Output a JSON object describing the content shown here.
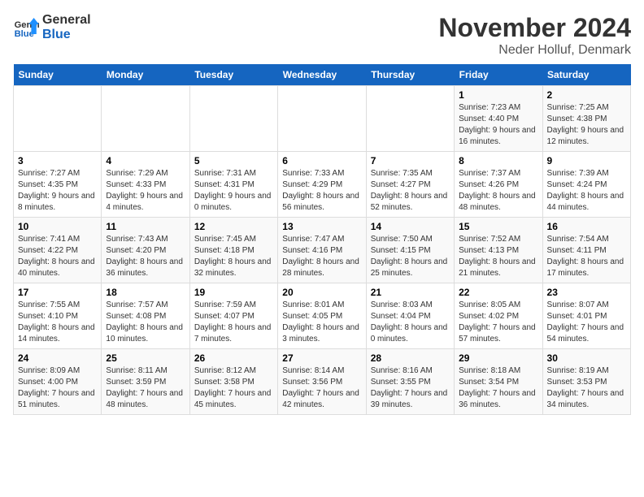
{
  "header": {
    "logo_line1": "General",
    "logo_line2": "Blue",
    "title": "November 2024",
    "subtitle": "Neder Holluf, Denmark"
  },
  "days_of_week": [
    "Sunday",
    "Monday",
    "Tuesday",
    "Wednesday",
    "Thursday",
    "Friday",
    "Saturday"
  ],
  "weeks": [
    [
      {
        "day": "",
        "detail": ""
      },
      {
        "day": "",
        "detail": ""
      },
      {
        "day": "",
        "detail": ""
      },
      {
        "day": "",
        "detail": ""
      },
      {
        "day": "",
        "detail": ""
      },
      {
        "day": "1",
        "detail": "Sunrise: 7:23 AM\nSunset: 4:40 PM\nDaylight: 9 hours and 16 minutes."
      },
      {
        "day": "2",
        "detail": "Sunrise: 7:25 AM\nSunset: 4:38 PM\nDaylight: 9 hours and 12 minutes."
      }
    ],
    [
      {
        "day": "3",
        "detail": "Sunrise: 7:27 AM\nSunset: 4:35 PM\nDaylight: 9 hours and 8 minutes."
      },
      {
        "day": "4",
        "detail": "Sunrise: 7:29 AM\nSunset: 4:33 PM\nDaylight: 9 hours and 4 minutes."
      },
      {
        "day": "5",
        "detail": "Sunrise: 7:31 AM\nSunset: 4:31 PM\nDaylight: 9 hours and 0 minutes."
      },
      {
        "day": "6",
        "detail": "Sunrise: 7:33 AM\nSunset: 4:29 PM\nDaylight: 8 hours and 56 minutes."
      },
      {
        "day": "7",
        "detail": "Sunrise: 7:35 AM\nSunset: 4:27 PM\nDaylight: 8 hours and 52 minutes."
      },
      {
        "day": "8",
        "detail": "Sunrise: 7:37 AM\nSunset: 4:26 PM\nDaylight: 8 hours and 48 minutes."
      },
      {
        "day": "9",
        "detail": "Sunrise: 7:39 AM\nSunset: 4:24 PM\nDaylight: 8 hours and 44 minutes."
      }
    ],
    [
      {
        "day": "10",
        "detail": "Sunrise: 7:41 AM\nSunset: 4:22 PM\nDaylight: 8 hours and 40 minutes."
      },
      {
        "day": "11",
        "detail": "Sunrise: 7:43 AM\nSunset: 4:20 PM\nDaylight: 8 hours and 36 minutes."
      },
      {
        "day": "12",
        "detail": "Sunrise: 7:45 AM\nSunset: 4:18 PM\nDaylight: 8 hours and 32 minutes."
      },
      {
        "day": "13",
        "detail": "Sunrise: 7:47 AM\nSunset: 4:16 PM\nDaylight: 8 hours and 28 minutes."
      },
      {
        "day": "14",
        "detail": "Sunrise: 7:50 AM\nSunset: 4:15 PM\nDaylight: 8 hours and 25 minutes."
      },
      {
        "day": "15",
        "detail": "Sunrise: 7:52 AM\nSunset: 4:13 PM\nDaylight: 8 hours and 21 minutes."
      },
      {
        "day": "16",
        "detail": "Sunrise: 7:54 AM\nSunset: 4:11 PM\nDaylight: 8 hours and 17 minutes."
      }
    ],
    [
      {
        "day": "17",
        "detail": "Sunrise: 7:55 AM\nSunset: 4:10 PM\nDaylight: 8 hours and 14 minutes."
      },
      {
        "day": "18",
        "detail": "Sunrise: 7:57 AM\nSunset: 4:08 PM\nDaylight: 8 hours and 10 minutes."
      },
      {
        "day": "19",
        "detail": "Sunrise: 7:59 AM\nSunset: 4:07 PM\nDaylight: 8 hours and 7 minutes."
      },
      {
        "day": "20",
        "detail": "Sunrise: 8:01 AM\nSunset: 4:05 PM\nDaylight: 8 hours and 3 minutes."
      },
      {
        "day": "21",
        "detail": "Sunrise: 8:03 AM\nSunset: 4:04 PM\nDaylight: 8 hours and 0 minutes."
      },
      {
        "day": "22",
        "detail": "Sunrise: 8:05 AM\nSunset: 4:02 PM\nDaylight: 7 hours and 57 minutes."
      },
      {
        "day": "23",
        "detail": "Sunrise: 8:07 AM\nSunset: 4:01 PM\nDaylight: 7 hours and 54 minutes."
      }
    ],
    [
      {
        "day": "24",
        "detail": "Sunrise: 8:09 AM\nSunset: 4:00 PM\nDaylight: 7 hours and 51 minutes."
      },
      {
        "day": "25",
        "detail": "Sunrise: 8:11 AM\nSunset: 3:59 PM\nDaylight: 7 hours and 48 minutes."
      },
      {
        "day": "26",
        "detail": "Sunrise: 8:12 AM\nSunset: 3:58 PM\nDaylight: 7 hours and 45 minutes."
      },
      {
        "day": "27",
        "detail": "Sunrise: 8:14 AM\nSunset: 3:56 PM\nDaylight: 7 hours and 42 minutes."
      },
      {
        "day": "28",
        "detail": "Sunrise: 8:16 AM\nSunset: 3:55 PM\nDaylight: 7 hours and 39 minutes."
      },
      {
        "day": "29",
        "detail": "Sunrise: 8:18 AM\nSunset: 3:54 PM\nDaylight: 7 hours and 36 minutes."
      },
      {
        "day": "30",
        "detail": "Sunrise: 8:19 AM\nSunset: 3:53 PM\nDaylight: 7 hours and 34 minutes."
      }
    ]
  ]
}
